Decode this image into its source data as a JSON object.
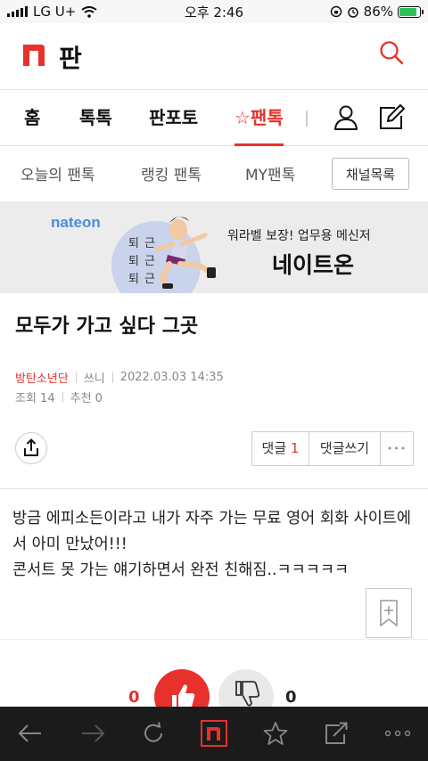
{
  "status_bar": {
    "carrier": "LG U+",
    "time": "오후 2:46",
    "battery": "86%",
    "battery_level": 0.86
  },
  "header": {
    "logo_letter": "n",
    "title": "판"
  },
  "main_nav": {
    "tabs": [
      {
        "label": "홈"
      },
      {
        "label": "톡톡"
      },
      {
        "label": "판포토"
      },
      {
        "label": "☆팬톡",
        "active": true
      }
    ]
  },
  "sub_nav": {
    "items": [
      {
        "label": "오늘의 팬톡"
      },
      {
        "label": "랭킹 팬톡"
      },
      {
        "label": "MY팬톡"
      }
    ],
    "channel_button": "채널목록"
  },
  "banner": {
    "brand": "nateon",
    "vertical_text": [
      "퇴",
      "근",
      "퇴",
      "근",
      "퇴",
      "근"
    ],
    "tagline": "워라벨 보장! 업무용 메신저",
    "product": "네이트온"
  },
  "post": {
    "title": "모두가 가고 싶다 그곳",
    "author": "방탄소년단",
    "writer": "쓰니",
    "date": "2022.03.03 14:35",
    "views": "조회 14",
    "recommend": "추천 0",
    "comment_label": "댓글",
    "comment_count": "1",
    "write_comment": "댓글쓰기",
    "more": "•••",
    "body_lines": [
      "방금 에피소든이라고 내가 자주 가는 무료 영어 회화 사이트에",
      "서 아미 만났어!!!",
      "콘서트 못 가는 얘기하면서 완전 친해짐..ㅋㅋㅋㅋㅋ"
    ],
    "like_count": "0",
    "dislike_count": "0"
  },
  "colors": {
    "accent": "#e8312c",
    "bottom_bar": "#1b1b1b"
  }
}
